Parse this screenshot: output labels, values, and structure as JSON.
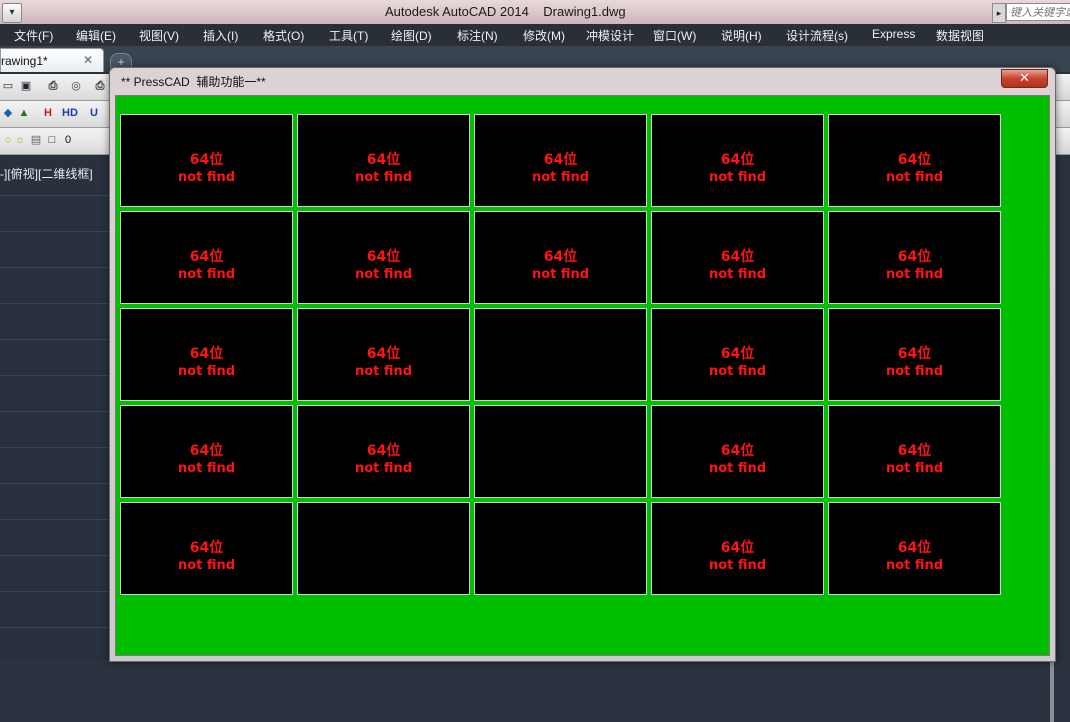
{
  "window": {
    "title": "Autodesk AutoCAD 2014    Drawing1.dwg",
    "search_placeholder": "键入关键字或",
    "sysmenu_icon": "chevron-down-icon"
  },
  "menu": {
    "items": [
      "文件(F)",
      "编辑(E)",
      "视图(V)",
      "插入(I)",
      "格式(O)",
      "工具(T)",
      "绘图(D)",
      "标注(N)",
      "修改(M)",
      "冲模设计",
      "窗口(W)",
      "说明(H)",
      "设计流程(s)",
      "Express",
      "数据视图"
    ]
  },
  "tabs": {
    "doc_tab_label": "rawing1*",
    "close_glyph": "✕",
    "new_tab_glyph": "+"
  },
  "left_panel": {
    "view_label": "-][俯视][二维线框]",
    "layer_value": "0"
  },
  "dialog": {
    "title": "** PressCAD  辅助功能一**",
    "close_glyph": "✕",
    "background_color": "#00bf00"
  },
  "grid": {
    "rows": [
      [
        {
          "line1": "64位",
          "line2": "not find"
        },
        {
          "line1": "64位",
          "line2": "not find"
        },
        {
          "line1": "64位",
          "line2": "not find"
        },
        {
          "line1": "64位",
          "line2": "not find"
        },
        {
          "line1": "64位",
          "line2": "not find"
        }
      ],
      [
        {
          "line1": "64位",
          "line2": "not find"
        },
        {
          "line1": "64位",
          "line2": "not find"
        },
        {
          "line1": "64位",
          "line2": "not find"
        },
        {
          "line1": "64位",
          "line2": "not find"
        },
        {
          "line1": "64位",
          "line2": "not find"
        }
      ],
      [
        {
          "line1": "64位",
          "line2": "not find"
        },
        {
          "line1": "64位",
          "line2": "not find"
        },
        {
          "line1": "",
          "line2": ""
        },
        {
          "line1": "64位",
          "line2": "not find"
        },
        {
          "line1": "64位",
          "line2": "not find"
        }
      ],
      [
        {
          "line1": "64位",
          "line2": "not find"
        },
        {
          "line1": "64位",
          "line2": "not find"
        },
        {
          "line1": "",
          "line2": ""
        },
        {
          "line1": "64位",
          "line2": "not find"
        },
        {
          "line1": "64位",
          "line2": "not find"
        }
      ],
      [
        {
          "line1": "64位",
          "line2": "not find"
        },
        {
          "line1": "",
          "line2": ""
        },
        {
          "line1": "",
          "line2": ""
        },
        {
          "line1": "64位",
          "line2": "not find"
        },
        {
          "line1": "64位",
          "line2": "not find"
        }
      ]
    ],
    "text_color": "#ff1414"
  }
}
